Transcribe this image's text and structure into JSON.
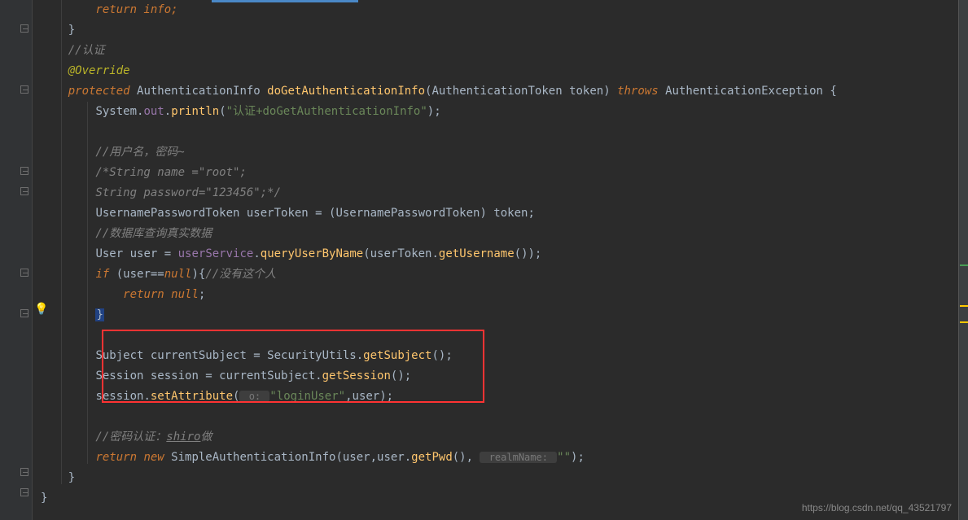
{
  "code": {
    "l1": "        return info;",
    "l2": "    }",
    "l3_cm": "    //认证",
    "l4_ann": "    @Override",
    "l5": {
      "kw": "    protected ",
      "type1": "AuthenticationInfo ",
      "fn": "doGetAuthenticationInfo",
      "p1": "(",
      "type2": "AuthenticationToken ",
      "arg": "token",
      "p2": ") ",
      "kw2": "throws ",
      "exc": "AuthenticationException {"
    },
    "l6": {
      "ind": "        ",
      "sys": "System",
      "dot1": ".",
      "out": "out",
      "dot2": ".",
      "fn": "println",
      "p1": "(",
      "str": "\"认证+doGetAuthenticationInfo\"",
      "p2": ");"
    },
    "l8_cm": "        //用户名，密码~",
    "l9_cm": "        /*String name =\"root\";",
    "l10_cm": "        String password=\"123456\";*/",
    "l11": {
      "ind": "        ",
      "type": "UsernamePasswordToken ",
      "var": "userToken = (UsernamePasswordToken) token;"
    },
    "l12_cm": "        //数据库查询真实数据",
    "l13": {
      "ind": "        ",
      "type": "User ",
      "var": "user = ",
      "field": "userService",
      "dot": ".",
      "fn": "queryUserByName",
      "p1": "(userToken.",
      "fn2": "getUsername",
      "p2": "());"
    },
    "l14": {
      "ind": "        ",
      "kw": "if ",
      "p1": "(user==",
      "null": "null",
      "p2": "){",
      "cm": "//没有这个人"
    },
    "l15": {
      "ind": "            ",
      "kw": "return ",
      "null": "null",
      "p": ";"
    },
    "l16": {
      "ind": "        ",
      "brace": "}"
    },
    "l18": {
      "ind": "        ",
      "type": "Subject ",
      "var": "currentSubject = SecurityUtils.",
      "fn": "getSubject",
      "p": "();"
    },
    "l19": {
      "ind": "        ",
      "type": "Session ",
      "var": "session = currentSubject.",
      "fn": "getSession",
      "p": "();"
    },
    "l20": {
      "ind": "        ",
      "var": "session.",
      "fn": "setAttribute",
      "p1": "(",
      "hint": " o: ",
      "str": "\"loginUser\"",
      "p2": ",user);"
    },
    "l22": {
      "cm1": "        //密码认证：",
      "cm2": "shiro",
      "cm3": "做"
    },
    "l23": {
      "ind": "        ",
      "kw": "return new ",
      "type": "SimpleAuthenticationInfo",
      "p1": "(user,user.",
      "fn": "getPwd",
      "p2": "(), ",
      "hint": " realmName: ",
      "str": "\"\"",
      "p3": ");"
    },
    "l24": "    }",
    "l25": "}"
  },
  "watermark": "https://blog.csdn.net/qq_43521797"
}
